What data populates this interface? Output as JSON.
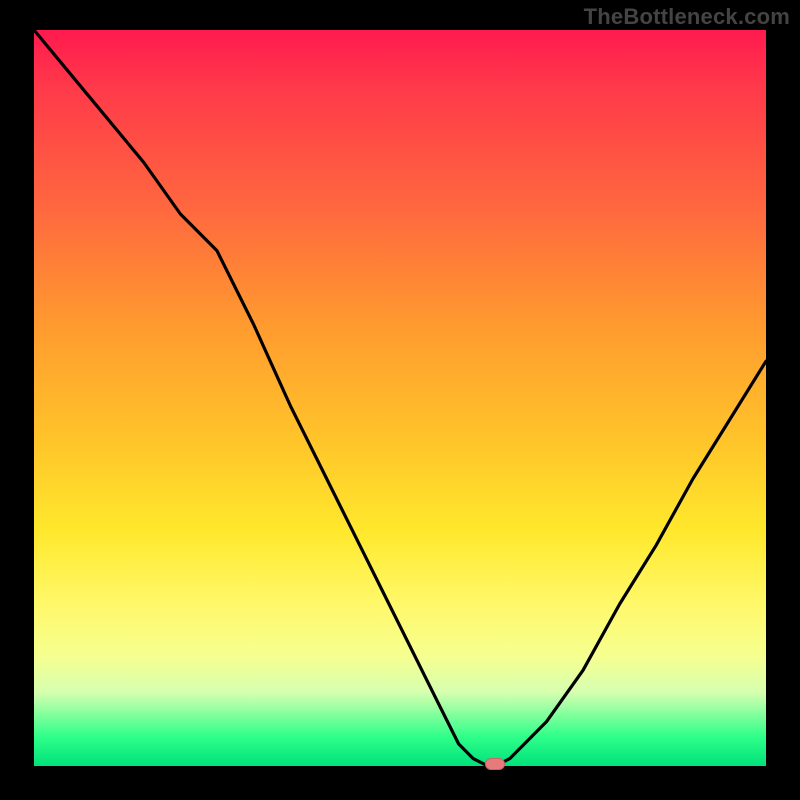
{
  "watermark": "TheBottleneck.com",
  "chart_data": {
    "type": "line",
    "title": "",
    "xlabel": "",
    "ylabel": "",
    "xlim": [
      0,
      100
    ],
    "ylim": [
      0,
      100
    ],
    "grid": false,
    "legend": false,
    "curve_description": "black bottleneck curve descending from top-left to a minimum near x≈63 then rising toward right edge",
    "x": [
      0,
      5,
      10,
      15,
      20,
      25,
      30,
      35,
      40,
      45,
      50,
      55,
      58,
      60,
      62,
      63,
      65,
      70,
      75,
      80,
      85,
      90,
      95,
      100
    ],
    "values": [
      100,
      94,
      88,
      82,
      75,
      70,
      60,
      49,
      39,
      29,
      19,
      9,
      3,
      1,
      0,
      0,
      1,
      6,
      13,
      22,
      30,
      39,
      47,
      55
    ],
    "optimal_marker": {
      "x": 63,
      "y": 0,
      "shape": "rounded-rect",
      "color": "#e77b7b"
    },
    "gradient_stops": [
      {
        "pos": 0,
        "color": "#ff1a4f"
      },
      {
        "pos": 25,
        "color": "#ff6a3e"
      },
      {
        "pos": 55,
        "color": "#ffc22a"
      },
      {
        "pos": 78,
        "color": "#fff86a"
      },
      {
        "pos": 96,
        "color": "#2fff8a"
      },
      {
        "pos": 100,
        "color": "#00e27a"
      }
    ]
  }
}
